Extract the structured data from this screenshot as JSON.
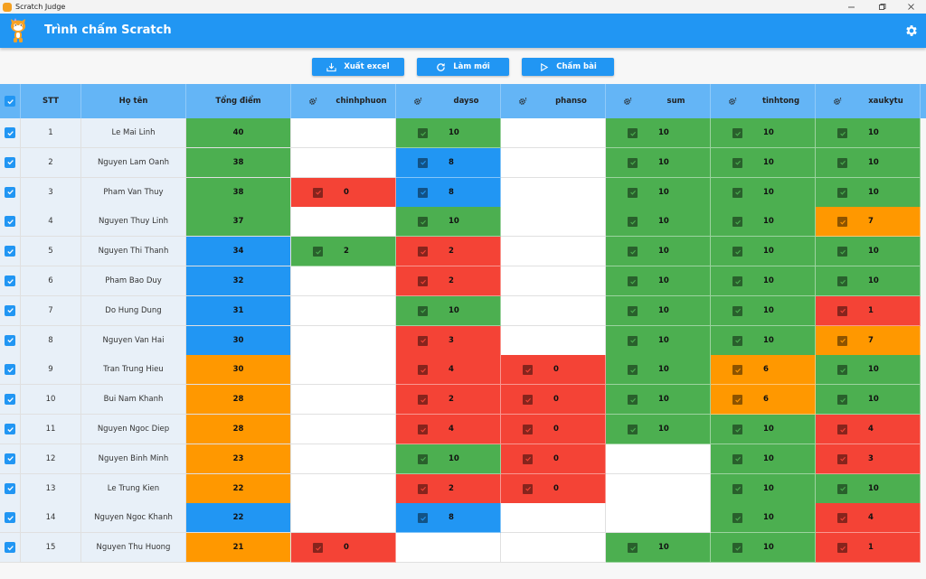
{
  "window": {
    "title": "Scratch Judge",
    "controls": [
      "minimize",
      "maximize",
      "close"
    ]
  },
  "appbar": {
    "title": "Trình chấm Scratch",
    "logo_icon": "scratch-cat-logo",
    "settings_icon": "gear-icon"
  },
  "toolbar": {
    "export_label": "Xuất excel",
    "refresh_label": "Làm mới",
    "grade_label": "Chấm bài"
  },
  "colors": {
    "primary": "#2196f3",
    "header": "#64b5f6",
    "green": "#4caf50",
    "blue": "#2196f3",
    "red": "#f44336",
    "orange": "#ff9800"
  },
  "table": {
    "select_all_checked": true,
    "columns": {
      "stt": "STT",
      "name": "Họ tên",
      "total": "Tổng điểm",
      "tasks": [
        "chinhphuon",
        "dayso",
        "phanso",
        "sum",
        "tinhtong",
        "xaukytu"
      ]
    },
    "rows": [
      {
        "stt": "1",
        "name": "Le Mai Linh",
        "total": "40",
        "total_color": "green",
        "scores": [
          null,
          {
            "v": "10",
            "c": "green"
          },
          null,
          {
            "v": "10",
            "c": "green"
          },
          {
            "v": "10",
            "c": "green"
          },
          {
            "v": "10",
            "c": "green"
          }
        ]
      },
      {
        "stt": "2",
        "name": "Nguyen Lam Oanh",
        "total": "38",
        "total_color": "green",
        "scores": [
          null,
          {
            "v": "8",
            "c": "blue"
          },
          null,
          {
            "v": "10",
            "c": "green"
          },
          {
            "v": "10",
            "c": "green"
          },
          {
            "v": "10",
            "c": "green"
          }
        ]
      },
      {
        "stt": "3",
        "name": "Pham Van Thuy",
        "total": "38",
        "total_color": "green",
        "scores": [
          {
            "v": "0",
            "c": "red"
          },
          {
            "v": "8",
            "c": "blue"
          },
          null,
          {
            "v": "10",
            "c": "green"
          },
          {
            "v": "10",
            "c": "green"
          },
          {
            "v": "10",
            "c": "green"
          }
        ]
      },
      {
        "stt": "4",
        "name": "Nguyen Thuy Linh",
        "total": "37",
        "total_color": "green",
        "scores": [
          null,
          {
            "v": "10",
            "c": "green"
          },
          null,
          {
            "v": "10",
            "c": "green"
          },
          {
            "v": "10",
            "c": "green"
          },
          {
            "v": "7",
            "c": "orange"
          }
        ]
      },
      {
        "stt": "5",
        "name": "Nguyen Thi Thanh",
        "total": "34",
        "total_color": "blue",
        "scores": [
          {
            "v": "2",
            "c": "green"
          },
          {
            "v": "2",
            "c": "red"
          },
          null,
          {
            "v": "10",
            "c": "green"
          },
          {
            "v": "10",
            "c": "green"
          },
          {
            "v": "10",
            "c": "green"
          }
        ]
      },
      {
        "stt": "6",
        "name": "Pham Bao Duy",
        "total": "32",
        "total_color": "blue",
        "scores": [
          null,
          {
            "v": "2",
            "c": "red"
          },
          null,
          {
            "v": "10",
            "c": "green"
          },
          {
            "v": "10",
            "c": "green"
          },
          {
            "v": "10",
            "c": "green"
          }
        ]
      },
      {
        "stt": "7",
        "name": "Do Hung Dung",
        "total": "31",
        "total_color": "blue",
        "scores": [
          null,
          {
            "v": "10",
            "c": "green"
          },
          null,
          {
            "v": "10",
            "c": "green"
          },
          {
            "v": "10",
            "c": "green"
          },
          {
            "v": "1",
            "c": "red"
          }
        ]
      },
      {
        "stt": "8",
        "name": "Nguyen Van Hai",
        "total": "30",
        "total_color": "blue",
        "scores": [
          null,
          {
            "v": "3",
            "c": "red"
          },
          null,
          {
            "v": "10",
            "c": "green"
          },
          {
            "v": "10",
            "c": "green"
          },
          {
            "v": "7",
            "c": "orange"
          }
        ]
      },
      {
        "stt": "9",
        "name": "Tran Trung Hieu",
        "total": "30",
        "total_color": "orange",
        "scores": [
          null,
          {
            "v": "4",
            "c": "red"
          },
          {
            "v": "0",
            "c": "red"
          },
          {
            "v": "10",
            "c": "green"
          },
          {
            "v": "6",
            "c": "orange"
          },
          {
            "v": "10",
            "c": "green"
          }
        ]
      },
      {
        "stt": "10",
        "name": "Bui Nam Khanh",
        "total": "28",
        "total_color": "orange",
        "scores": [
          null,
          {
            "v": "2",
            "c": "red"
          },
          {
            "v": "0",
            "c": "red"
          },
          {
            "v": "10",
            "c": "green"
          },
          {
            "v": "6",
            "c": "orange"
          },
          {
            "v": "10",
            "c": "green"
          }
        ]
      },
      {
        "stt": "11",
        "name": "Nguyen Ngoc Diep",
        "total": "28",
        "total_color": "orange",
        "scores": [
          null,
          {
            "v": "4",
            "c": "red"
          },
          {
            "v": "0",
            "c": "red"
          },
          {
            "v": "10",
            "c": "green"
          },
          {
            "v": "10",
            "c": "green"
          },
          {
            "v": "4",
            "c": "red"
          }
        ]
      },
      {
        "stt": "12",
        "name": "Nguyen Binh Minh",
        "total": "23",
        "total_color": "orange",
        "scores": [
          null,
          {
            "v": "10",
            "c": "green"
          },
          {
            "v": "0",
            "c": "red"
          },
          null,
          {
            "v": "10",
            "c": "green"
          },
          {
            "v": "3",
            "c": "red"
          }
        ]
      },
      {
        "stt": "13",
        "name": "Le Trung Kien",
        "total": "22",
        "total_color": "orange",
        "scores": [
          null,
          {
            "v": "2",
            "c": "red"
          },
          {
            "v": "0",
            "c": "red"
          },
          null,
          {
            "v": "10",
            "c": "green"
          },
          {
            "v": "10",
            "c": "green"
          }
        ]
      },
      {
        "stt": "14",
        "name": "Nguyen Ngoc Khanh",
        "total": "22",
        "total_color": "blue",
        "scores": [
          null,
          {
            "v": "8",
            "c": "blue"
          },
          null,
          null,
          {
            "v": "10",
            "c": "green"
          },
          {
            "v": "4",
            "c": "red"
          }
        ]
      },
      {
        "stt": "15",
        "name": "Nguyen Thu Huong",
        "total": "21",
        "total_color": "orange",
        "scores": [
          {
            "v": "0",
            "c": "red"
          },
          null,
          null,
          {
            "v": "10",
            "c": "green"
          },
          {
            "v": "10",
            "c": "green"
          },
          {
            "v": "1",
            "c": "red"
          }
        ]
      }
    ]
  }
}
